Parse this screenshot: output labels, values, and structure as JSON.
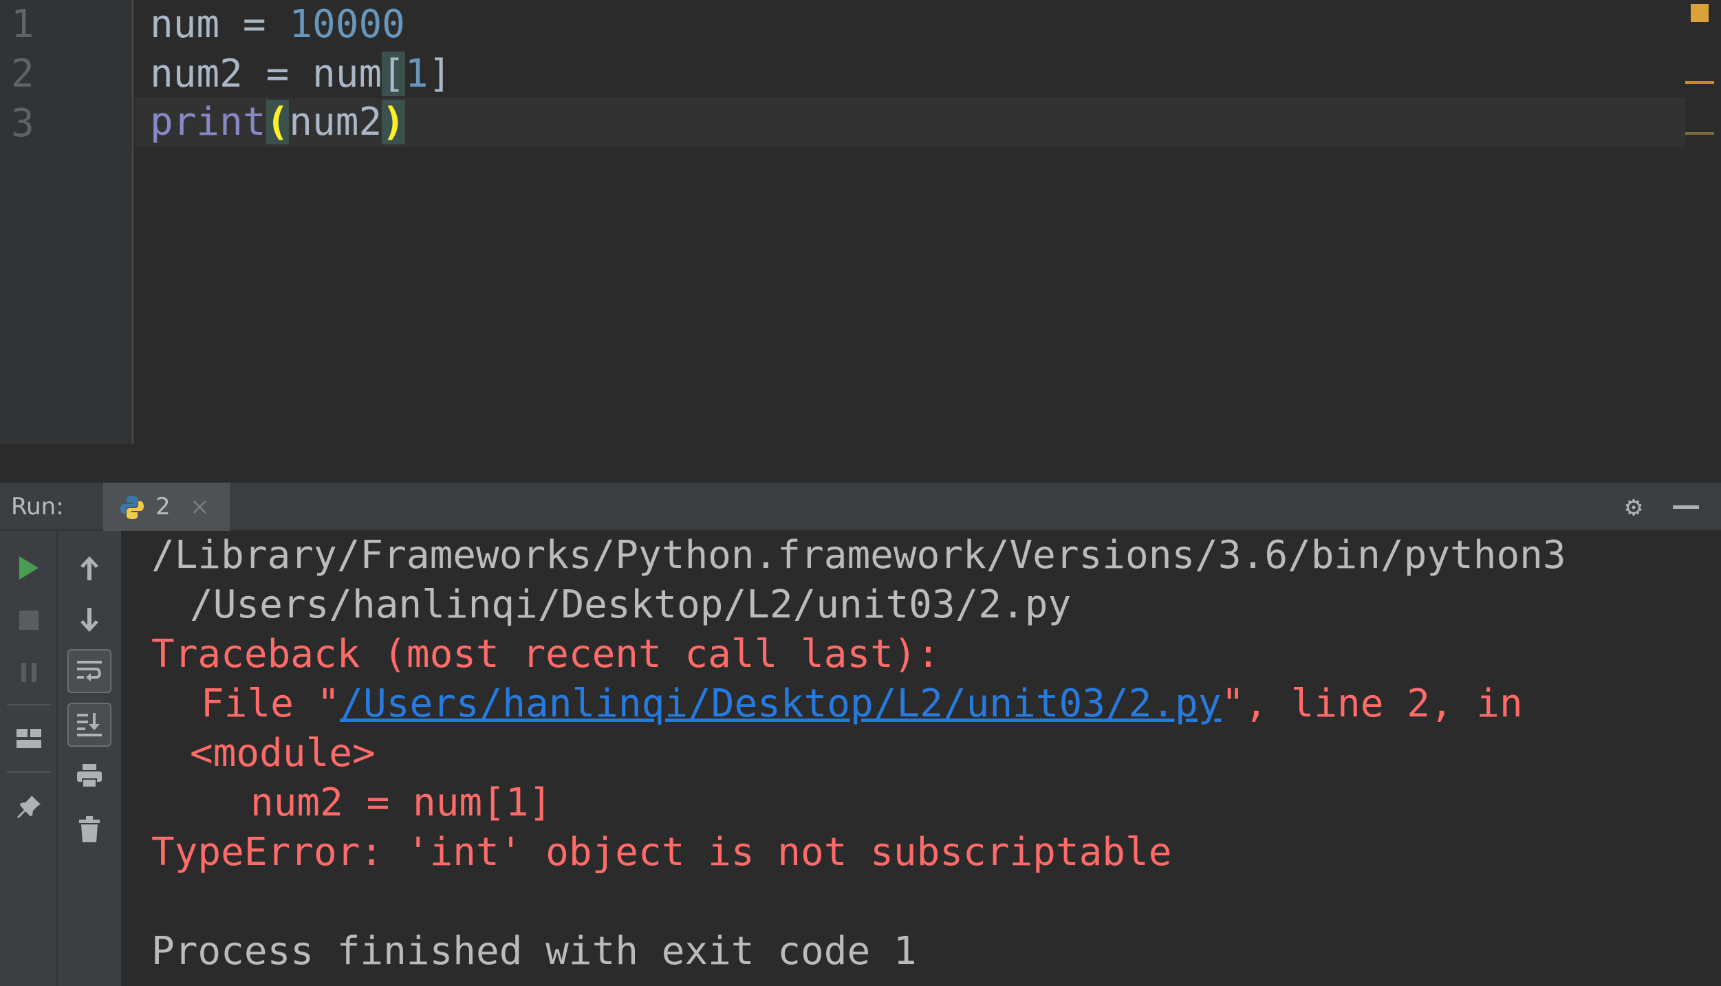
{
  "editor": {
    "line_numbers": [
      "1",
      "2",
      "3"
    ],
    "lines": [
      {
        "var": "num",
        "op": " = ",
        "value": "10000"
      },
      {
        "var": "num2",
        "op": " = ",
        "target": "num",
        "open": "[",
        "index": "1",
        "close": "]"
      },
      {
        "func": "print",
        "open": "(",
        "arg": "num2",
        "close": ")"
      }
    ]
  },
  "run_panel": {
    "label": "Run:",
    "tab": {
      "label": "2",
      "icon": "python-icon",
      "close": "×"
    },
    "icons": {
      "gear": "gear-icon",
      "minimize": "minimize-icon",
      "left_toolbar": [
        "run-icon",
        "stop-icon",
        "pause-icon",
        "layout-icon",
        "pin-icon"
      ],
      "right_toolbar": [
        "arrow-up-icon",
        "arrow-down-icon",
        "soft-wrap-icon",
        "scroll-to-end-icon",
        "print-icon",
        "trash-icon"
      ]
    },
    "console": {
      "cmd_line1": "/Library/Frameworks/Python.framework/Versions/3.6/bin/python3",
      "cmd_line2": "/Users/hanlinqi/Desktop/L2/unit03/2.py",
      "traceback_header": "Traceback (most recent call last):",
      "file_prefix": "File \"",
      "file_path": "/Users/hanlinqi/Desktop/L2/unit03/2.py",
      "file_suffix": "\", line 2, in",
      "module": "<module>",
      "code": "num2 = num[1]",
      "error": "TypeError: 'int' object is not subscriptable",
      "exit": "Process finished with exit code 1"
    }
  },
  "colors": {
    "editor_bg": "#2b2b2b",
    "number": "#6897bb",
    "builtin": "#8888c6",
    "error_text": "#ff6b68",
    "link": "#287bde",
    "run_green": "#499c54"
  }
}
